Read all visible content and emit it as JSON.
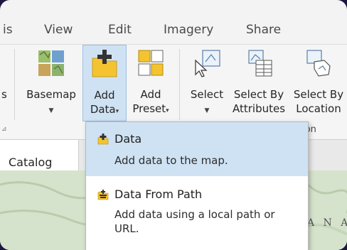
{
  "tabs": {
    "partial": "is",
    "view": "View",
    "edit": "Edit",
    "imagery": "Imagery",
    "share": "Share"
  },
  "ribbon": {
    "left_partial": "s",
    "basemap": {
      "line1": "Basemap",
      "caret": "▼"
    },
    "add_data": {
      "line1": "Add",
      "line2": "Data",
      "caret": "▾"
    },
    "add_preset": {
      "line1": "Add",
      "line2": "Preset",
      "caret": "▾"
    },
    "select": {
      "line1": "Select",
      "caret": "▼"
    },
    "select_by_attributes": {
      "line1": "Select By",
      "line2": "Attributes"
    },
    "select_by_location": {
      "line1": "Select By",
      "line2": "Location"
    },
    "group_label_partial": "tion"
  },
  "pane": {
    "catalog_tab": "Catalog"
  },
  "map": {
    "label_partial": "A N A"
  },
  "dropdown": {
    "items": [
      {
        "title": "Data",
        "description": "Add data to the map.",
        "icon": "add-data-icon"
      },
      {
        "title": "Data From Path",
        "description": "Add data using a local path or URL.",
        "icon": "data-from-path-icon"
      }
    ]
  },
  "colors": {
    "highlight": "#cfe2f3",
    "icon_yellow": "#f4c430",
    "background_frame": "#1d1640"
  }
}
